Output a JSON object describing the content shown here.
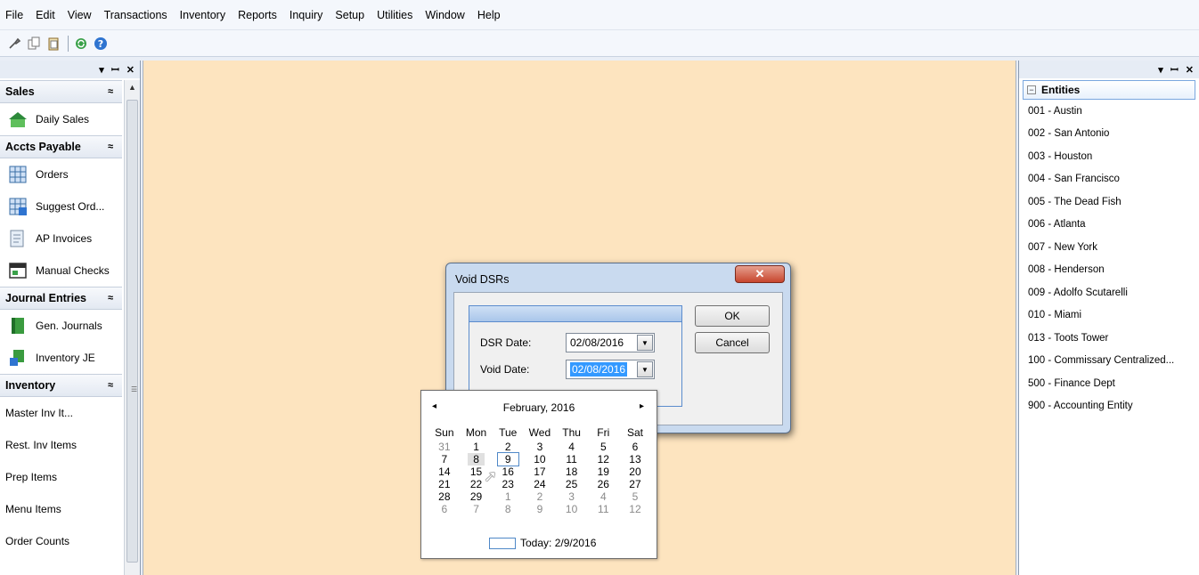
{
  "menu": [
    "File",
    "Edit",
    "View",
    "Transactions",
    "Inventory",
    "Reports",
    "Inquiry",
    "Setup",
    "Utilities",
    "Window",
    "Help"
  ],
  "toolbar": {
    "icons": [
      "wrench-icon",
      "copy-icon",
      "paste-icon",
      "refresh-icon",
      "help-icon"
    ]
  },
  "left_panel": {
    "header_controls": [
      "▾",
      "ꟷ",
      "✕"
    ],
    "groups": {
      "sales": {
        "title": "Sales",
        "items": [
          "Daily Sales"
        ]
      },
      "accts_payable": {
        "title": "Accts Payable",
        "items": [
          "Orders",
          "Suggest Ord...",
          "AP Invoices",
          "Manual Checks"
        ]
      },
      "journal_entries": {
        "title": "Journal Entries",
        "items": [
          "Gen. Journals",
          "Inventory JE"
        ]
      },
      "inventory": {
        "title": "Inventory",
        "items": [
          "Master Inv It...",
          "Rest. Inv Items",
          "Prep Items",
          "Menu Items",
          "Order Counts"
        ]
      }
    },
    "chevron": "≈"
  },
  "right_panel": {
    "title": "Entities",
    "entities": [
      "001 - Austin",
      "002 - San Antonio",
      "003 - Houston",
      "004 - San Francisco",
      "005 - The Dead Fish",
      "006 - Atlanta",
      "007 - New York",
      "008 - Henderson",
      "009 - Adolfo Scutarelli",
      "010 - Miami",
      "013 - Toots Tower",
      "100 - Commissary Centralized...",
      "500 - Finance Dept",
      "900 - Accounting Entity"
    ]
  },
  "dialog": {
    "title": "Void DSRs",
    "dsr_date_label": "DSR Date:",
    "dsr_date_value": "02/08/2016",
    "void_date_label": "Void Date:",
    "void_date_value": "02/08/2016",
    "ok_label": "OK",
    "cancel_label": "Cancel",
    "close_glyph": "✕"
  },
  "calendar": {
    "month_label": "February, 2016",
    "prev": "◂",
    "next": "▸",
    "dows": [
      "Sun",
      "Mon",
      "Tue",
      "Wed",
      "Thu",
      "Fri",
      "Sat"
    ],
    "weeks": [
      [
        "31",
        "1",
        "2",
        "3",
        "4",
        "5",
        "6"
      ],
      [
        "7",
        "8",
        "9",
        "10",
        "11",
        "12",
        "13"
      ],
      [
        "14",
        "15",
        "16",
        "17",
        "18",
        "19",
        "20"
      ],
      [
        "21",
        "22",
        "23",
        "24",
        "25",
        "26",
        "27"
      ],
      [
        "28",
        "29",
        "1",
        "2",
        "3",
        "4",
        "5"
      ],
      [
        "6",
        "7",
        "8",
        "9",
        "10",
        "11",
        "12"
      ]
    ],
    "today_label": "Today: 2/9/2016"
  }
}
